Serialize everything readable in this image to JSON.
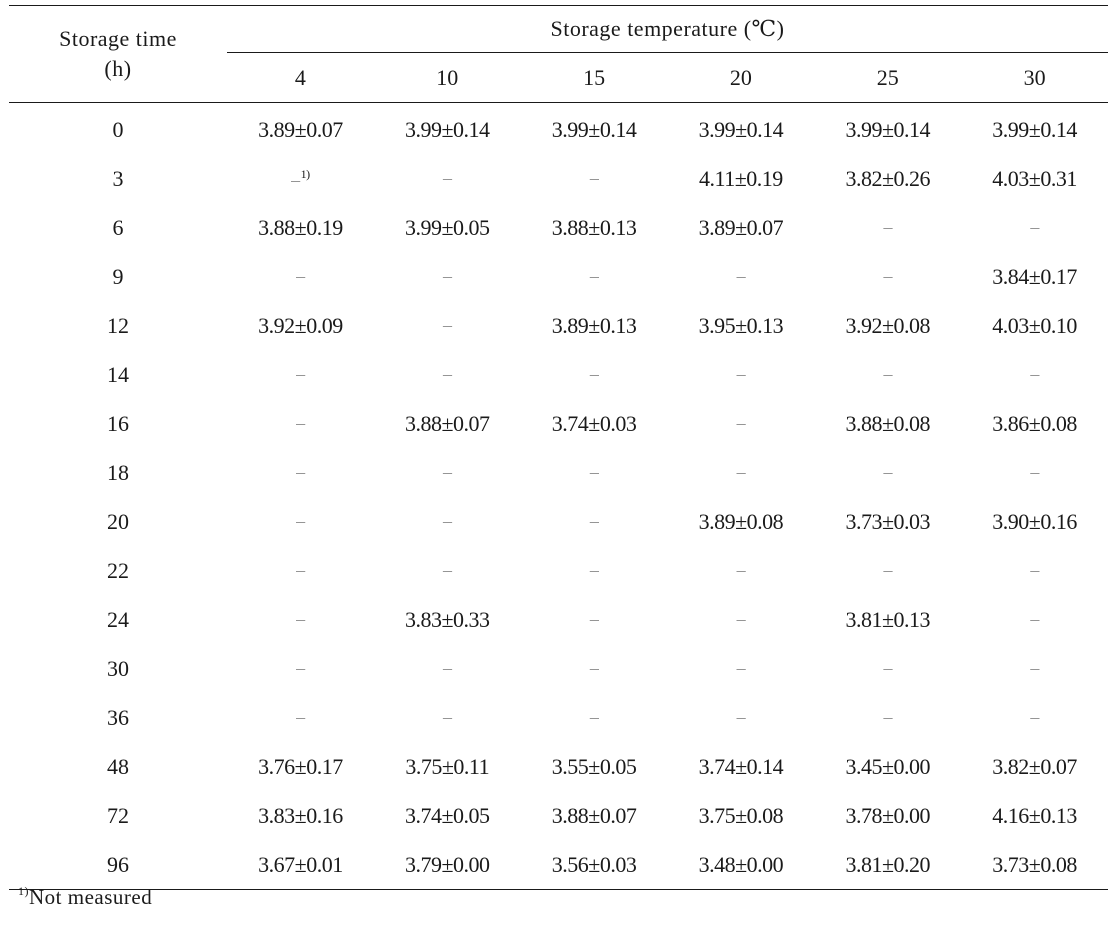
{
  "table": {
    "row_header_label_line1": "Storage time",
    "row_header_label_line2": "(h)",
    "column_group_label": "Storage temperature (℃)",
    "columns": [
      "4",
      "10",
      "15",
      "20",
      "25",
      "30"
    ],
    "rows": [
      {
        "time": "0",
        "values": [
          "3.89±0.07",
          "3.99±0.14",
          "3.99±0.14",
          "3.99±0.14",
          "3.99±0.14",
          "3.99±0.14"
        ]
      },
      {
        "time": "3",
        "values": [
          "–",
          "–",
          "–",
          "4.11±0.19",
          "3.82±0.26",
          "4.03±0.31"
        ]
      },
      {
        "time": "6",
        "values": [
          "3.88±0.19",
          "3.99±0.05",
          "3.88±0.13",
          "3.89±0.07",
          "–",
          "–"
        ]
      },
      {
        "time": "9",
        "values": [
          "–",
          "–",
          "–",
          "–",
          "–",
          "3.84±0.17"
        ]
      },
      {
        "time": "12",
        "values": [
          "3.92±0.09",
          "–",
          "3.89±0.13",
          "3.95±0.13",
          "3.92±0.08",
          "4.03±0.10"
        ]
      },
      {
        "time": "14",
        "values": [
          "–",
          "–",
          "–",
          "–",
          "–",
          "–"
        ]
      },
      {
        "time": "16",
        "values": [
          "–",
          "3.88±0.07",
          "3.74±0.03",
          "–",
          "3.88±0.08",
          "3.86±0.08"
        ]
      },
      {
        "time": "18",
        "values": [
          "–",
          "–",
          "–",
          "–",
          "–",
          "–"
        ]
      },
      {
        "time": "20",
        "values": [
          "–",
          "–",
          "–",
          "3.89±0.08",
          "3.73±0.03",
          "3.90±0.16"
        ]
      },
      {
        "time": "22",
        "values": [
          "–",
          "–",
          "–",
          "–",
          "–",
          "–"
        ]
      },
      {
        "time": "24",
        "values": [
          "–",
          "3.83±0.33",
          "–",
          "–",
          "3.81±0.13",
          "–"
        ]
      },
      {
        "time": "30",
        "values": [
          "–",
          "–",
          "–",
          "–",
          "–",
          "–"
        ]
      },
      {
        "time": "36",
        "values": [
          "–",
          "–",
          "–",
          "–",
          "–",
          "–"
        ]
      },
      {
        "time": "48",
        "values": [
          "3.76±0.17",
          "3.75±0.11",
          "3.55±0.05",
          "3.74±0.14",
          "3.45±0.00",
          "3.82±0.07"
        ]
      },
      {
        "time": "72",
        "values": [
          "3.83±0.16",
          "3.74±0.05",
          "3.88±0.07",
          "3.75±0.08",
          "3.78±0.00",
          "4.16±0.13"
        ]
      },
      {
        "time": "96",
        "values": [
          "3.67±0.01",
          "3.79±0.00",
          "3.56±0.03",
          "3.48±0.00",
          "3.81±0.20",
          "3.73±0.08"
        ]
      }
    ],
    "first_dash_footnote_marker": "1)"
  },
  "footnote": {
    "marker": "1)",
    "text": "Not measured"
  }
}
